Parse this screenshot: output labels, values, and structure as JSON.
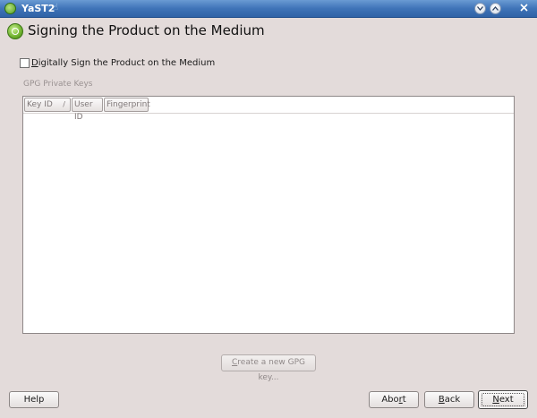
{
  "window": {
    "title": "YaST2",
    "icons": {
      "app": "yast-icon",
      "hand": "hand-icon",
      "minimize": "chevron-down-icon",
      "maximize": "chevron-up-icon",
      "close": "close-icon"
    }
  },
  "header": {
    "title": "Signing the Product on the Medium",
    "icon": "yast-product-icon"
  },
  "sign_checkbox": {
    "label_first": "D",
    "label_rest": "igitally Sign the Product on the Medium",
    "checked": false
  },
  "keys_group": {
    "label": "GPG Private Keys",
    "columns": [
      {
        "label": "Key ID",
        "sort": "/"
      },
      {
        "label": "User ID"
      },
      {
        "label": "Fingerprint"
      }
    ],
    "rows": []
  },
  "buttons": {
    "create_key": {
      "first": "C",
      "rest": "reate a new GPG key..."
    },
    "help": "Help",
    "abort": {
      "pre": "Abo",
      "u": "r",
      "post": "t"
    },
    "back": {
      "u": "B",
      "post": "ack"
    },
    "next": {
      "u": "N",
      "post": "ext"
    }
  }
}
